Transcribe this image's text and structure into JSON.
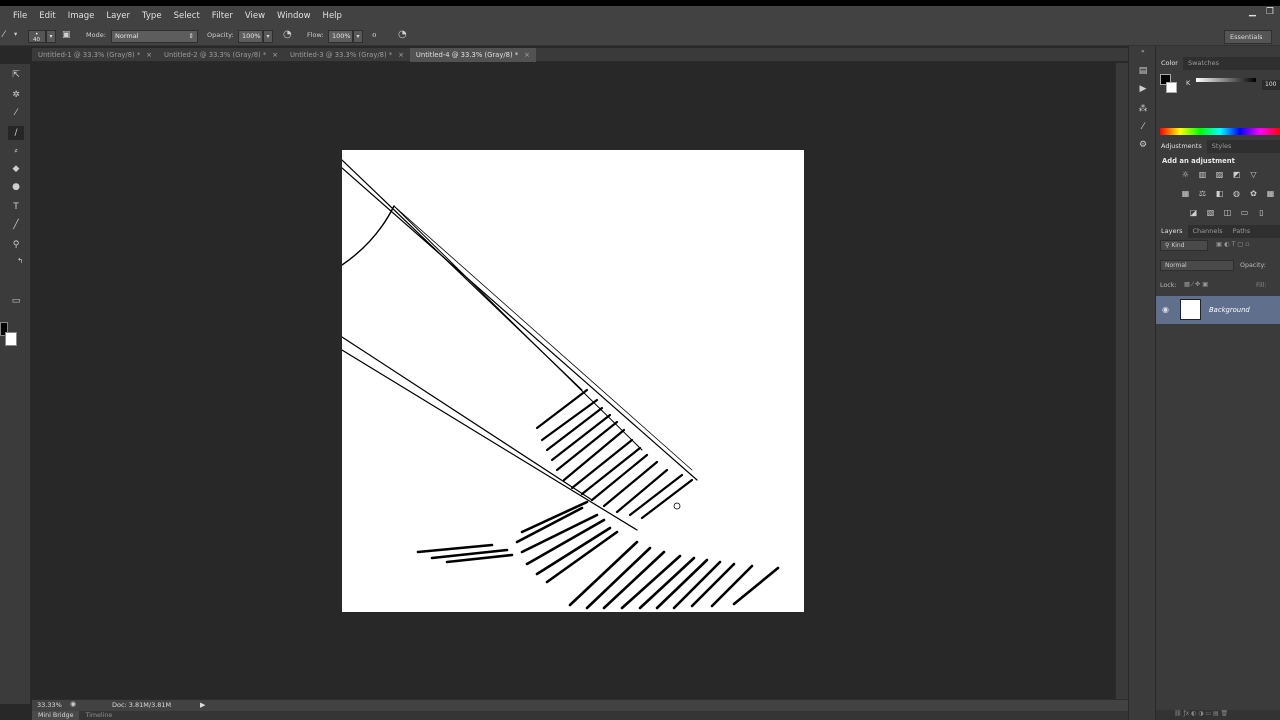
{
  "menubar": {
    "items": [
      "File",
      "Edit",
      "Image",
      "Layer",
      "Type",
      "Select",
      "Filter",
      "View",
      "Window",
      "Help"
    ],
    "minimize": "▁",
    "restore": "❐"
  },
  "options": {
    "brush_size": "40",
    "mode_label": "Mode:",
    "mode_value": "Normal",
    "opacity_label": "Opacity:",
    "opacity_value": "100%",
    "flow_label": "Flow:",
    "flow_value": "100%",
    "workspace": "Essentials"
  },
  "tabs": [
    {
      "label": "Untitled-1 @ 33.3% (Gray/8) *",
      "close": "×"
    },
    {
      "label": "Untitled-2 @ 33.3% (Gray/8) *",
      "close": "×"
    },
    {
      "label": "Untitled-3 @ 33.3% (Gray/8) *",
      "close": "×"
    },
    {
      "label": "Untitled-4 @ 33.3% (Gray/8) *",
      "close": "×"
    }
  ],
  "status": {
    "zoom": "33.33%",
    "doc": "Doc: 3.81M/3.81M"
  },
  "bottom_tabs": [
    "Mini Bridge",
    "Timeline"
  ],
  "color_panel": {
    "tabs": [
      "Color",
      "Swatches"
    ],
    "k_label": "K",
    "k_value": "100"
  },
  "adjustments_panel": {
    "tabs": [
      "Adjustments",
      "Styles"
    ],
    "heading": "Add an adjustment"
  },
  "layers_panel": {
    "tabs": [
      "Layers",
      "Channels",
      "Paths"
    ],
    "kind": "Kind",
    "blend_mode": "Normal",
    "opacity_label": "Opacity:",
    "lock_label": "Lock:",
    "fill_label": "Fill:",
    "layer_name": "Background"
  }
}
